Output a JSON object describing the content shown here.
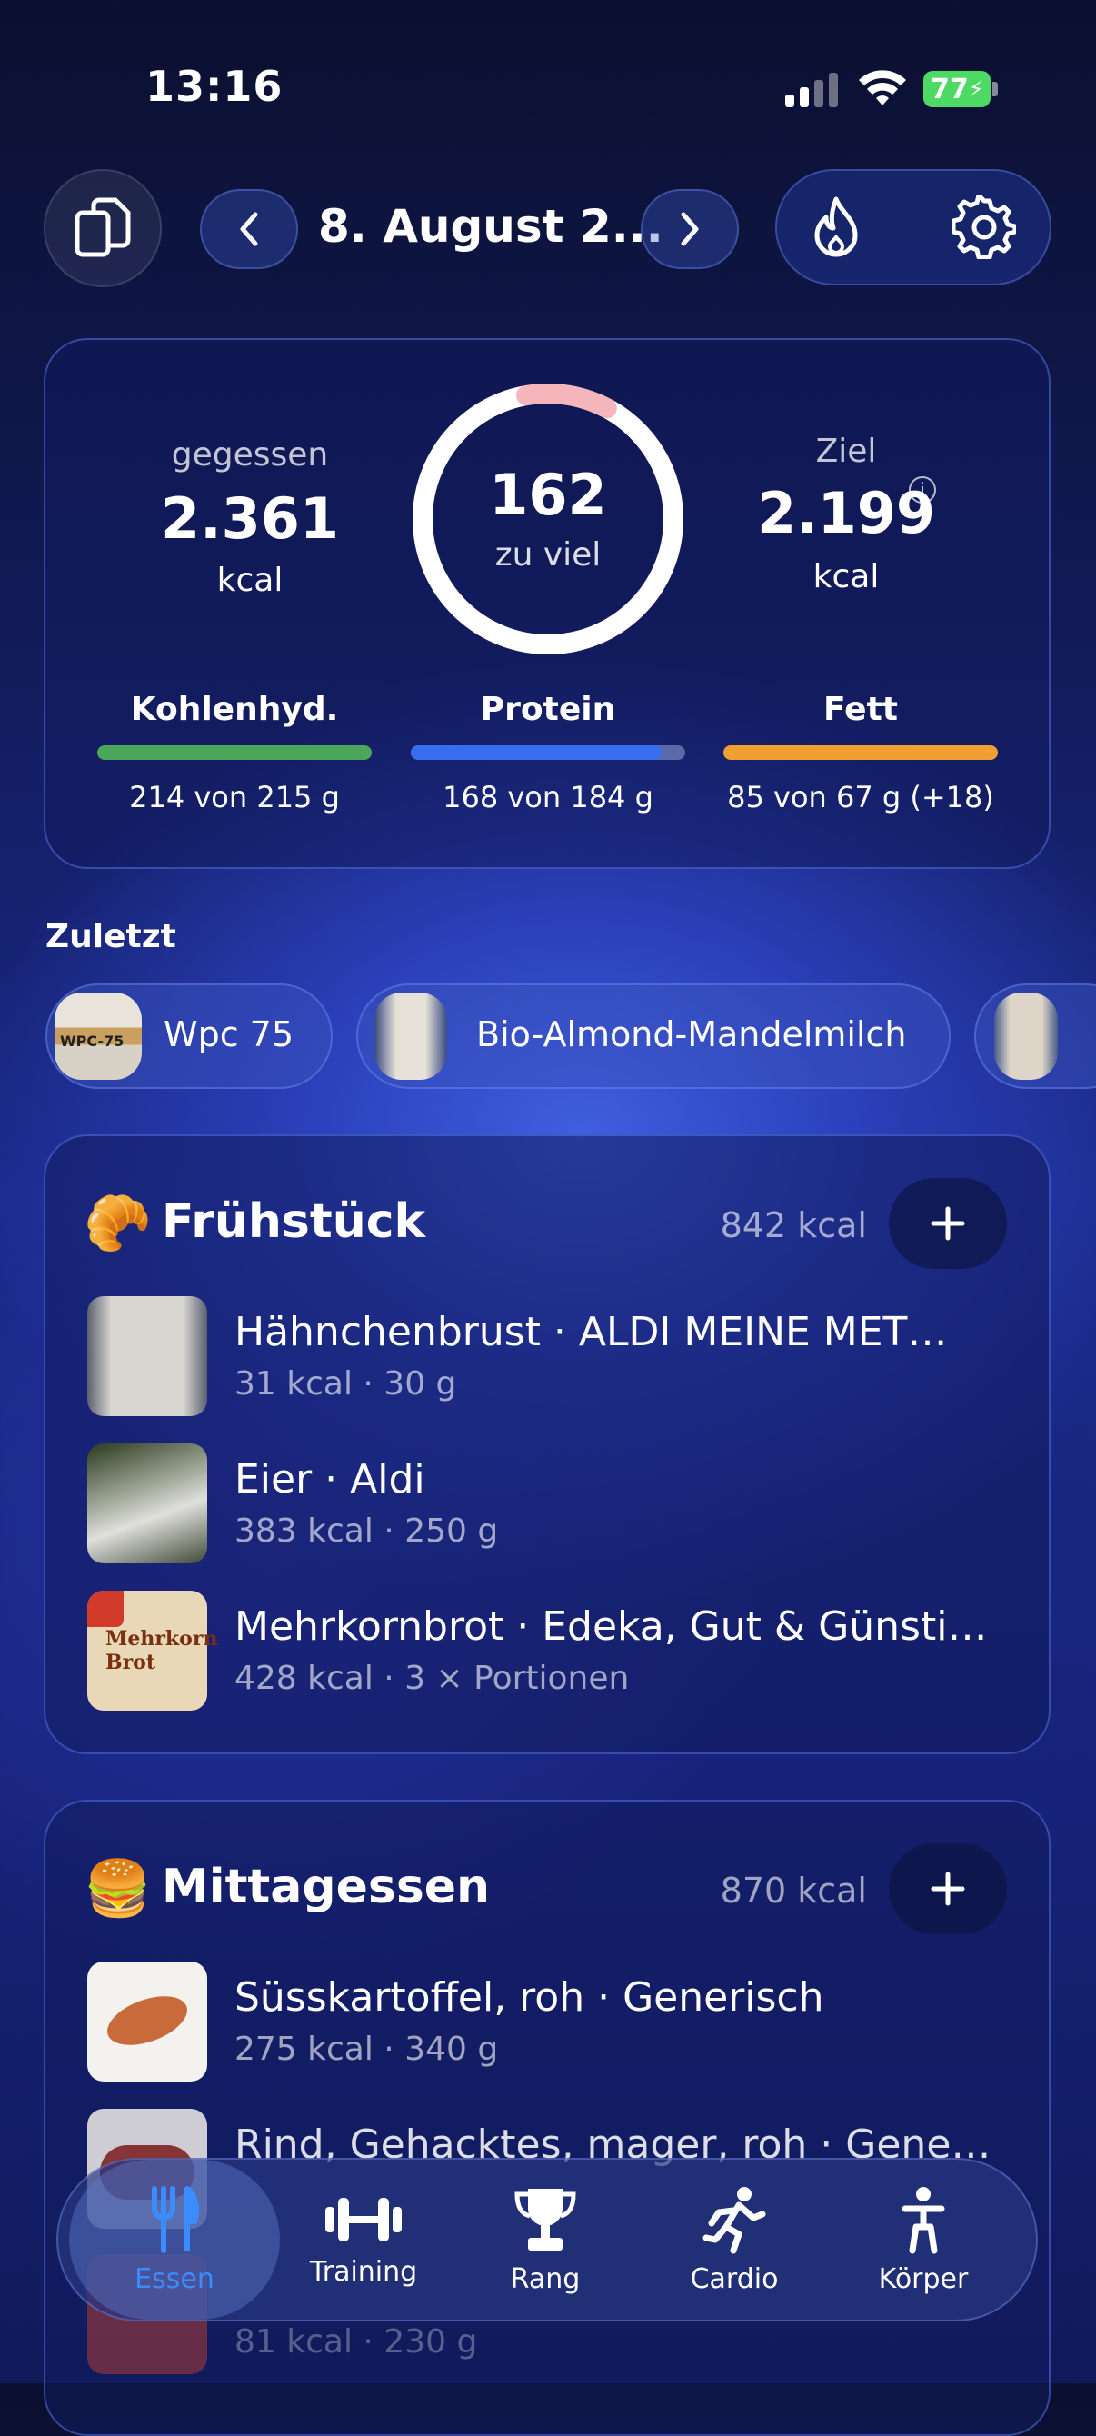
{
  "status": {
    "time": "13:16",
    "battery": "77"
  },
  "nav": {
    "date": "8. August 2..."
  },
  "summary": {
    "eaten_label": "gegessen",
    "eaten_value": "2.361",
    "eaten_unit": "kcal",
    "ring_value": "162",
    "ring_label": "zu viel",
    "goal_label": "Ziel",
    "goal_value": "2.199",
    "goal_unit": "kcal",
    "macros": [
      {
        "title": "Kohlenhyd.",
        "text": "214 von 215 g",
        "color": "#4ca65a",
        "fill": 0.995
      },
      {
        "title": "Protein",
        "text": "168 von 184 g",
        "color": "#3a6cf0",
        "fill": 0.913
      },
      {
        "title": "Fett",
        "text": "85 von 67 g (+18)",
        "color": "#f0a030",
        "fill": 1.0
      }
    ]
  },
  "recent": {
    "label": "Zuletzt",
    "items": [
      "Wpc 75",
      "Bio-Almond-Mandelmilch"
    ]
  },
  "meals": [
    {
      "emoji": "🥐",
      "title": "Frühstück",
      "kcal": "842 kcal",
      "items": [
        {
          "name": "Hähnchenbrust · ALDI MEINE MET…",
          "sub": "31 kcal · 30 g"
        },
        {
          "name": "Eier · Aldi",
          "sub": "383 kcal · 250 g"
        },
        {
          "name": "Mehrkornbrot · Edeka, Gut & Günsti…",
          "sub": "428 kcal · 3 × Portionen"
        }
      ]
    },
    {
      "emoji": "🍔",
      "title": "Mittagessen",
      "kcal": "870 kcal",
      "items": [
        {
          "name": "Süsskartoffel, roh · Generisch",
          "sub": "275 kcal · 340 g"
        },
        {
          "name": "Rind, Gehacktes, mager, roh · Gene…",
          "sub": ""
        },
        {
          "name": "",
          "sub": "81 kcal · 230 g"
        }
      ]
    }
  ],
  "tabs": [
    {
      "label": "Essen",
      "icon": "fork-knife-icon",
      "active": true
    },
    {
      "label": "Training",
      "icon": "dumbbell-icon",
      "active": false
    },
    {
      "label": "Rang",
      "icon": "trophy-icon",
      "active": false
    },
    {
      "label": "Cardio",
      "icon": "running-icon",
      "active": false
    },
    {
      "label": "Körper",
      "icon": "person-icon",
      "active": false
    }
  ],
  "colors": {
    "ring_over": "#f4b6bb",
    "accent_blue": "#3b8cff"
  }
}
